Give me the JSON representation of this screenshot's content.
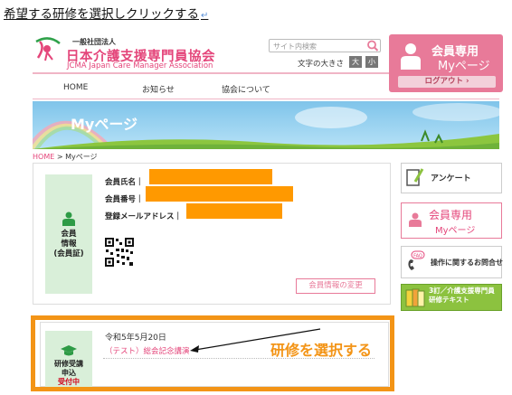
{
  "instruction": {
    "text": "希望する研修を選択しクリックする",
    "return_mark": "↵"
  },
  "header": {
    "org_small": "一般社団法人",
    "org_name": "日本介護支援専門員協会",
    "org_en": "JCMA Japan Care Manager Association",
    "search_placeholder": "サイト内検索",
    "font_size_label": "文字の大きさ",
    "font_large": "大",
    "font_small": "小"
  },
  "member_area": {
    "title": "会員専用",
    "subtitle": "Myページ",
    "logout": "ログアウト ›"
  },
  "nav": {
    "items": [
      "HOME",
      "お知らせ",
      "協会について"
    ]
  },
  "banner": {
    "title": "Myページ"
  },
  "breadcrumb": {
    "home": "HOME",
    "separator": " > ",
    "current": "Myページ"
  },
  "member_card": {
    "side_label": "会員\n情報\n(会員証)",
    "fields": [
      {
        "label": "会員氏名"
      },
      {
        "label": "会員番号"
      },
      {
        "label": "登録メールアドレス"
      }
    ],
    "change_button": "会員情報の変更"
  },
  "right_sidebar": {
    "enquete": "アンケート",
    "member_title": "会員専用",
    "member_subtitle": "Myページ",
    "faq": "操作に関するお問合せ",
    "textbook": "3訂／介護支援専門員\n研修テキスト"
  },
  "training_card": {
    "side_line1": "研修受講",
    "side_line2": "申込",
    "side_status": "受付中",
    "date": "令和5年5月20日",
    "course": "（テスト）総会記念講演"
  },
  "callout": {
    "text": "研修を選択する"
  },
  "colors": {
    "accent_pink": "#e87a99",
    "highlight_orange": "#f39416",
    "redaction": "#ff9900",
    "side_green": "#d9efd9"
  }
}
